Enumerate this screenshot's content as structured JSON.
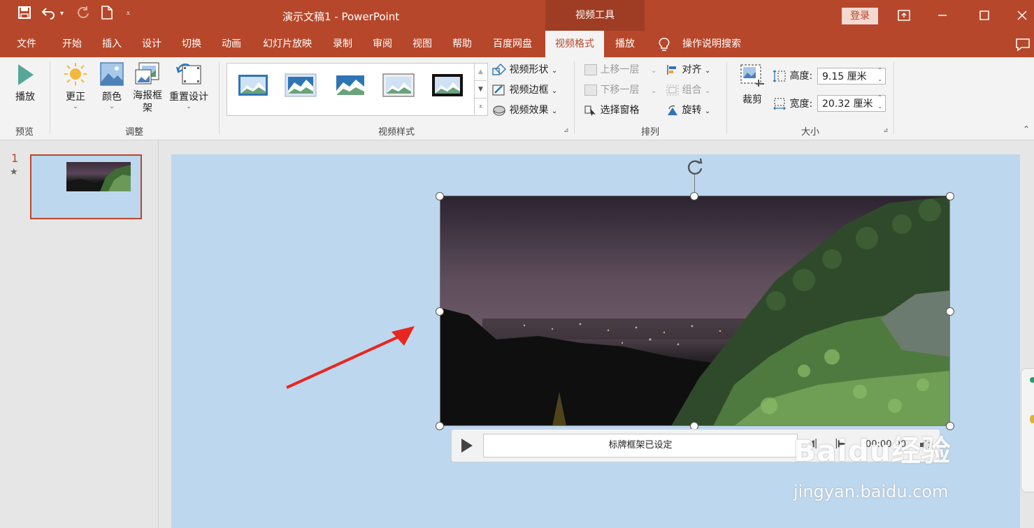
{
  "qat": {
    "save_icon": "save-icon",
    "undo_icon": "undo-icon",
    "redo_icon": "redo-icon",
    "new_icon": "new-file-icon",
    "more_icon": "customize-icon"
  },
  "titlebar": {
    "title": "演示文稿1  -  PowerPoint",
    "context_tab": "视频工具",
    "login": "登录"
  },
  "tabs": [
    "文件",
    "开始",
    "插入",
    "设计",
    "切换",
    "动画",
    "幻灯片放映",
    "录制",
    "审阅",
    "视图",
    "帮助",
    "百度网盘",
    "视频格式",
    "播放"
  ],
  "active_tab": "视频格式",
  "tellme": "操作说明搜索",
  "ribbon": {
    "preview": {
      "play": "播放",
      "group": "预览"
    },
    "adjust": {
      "correct": "更正",
      "color": "颜色",
      "poster": "海报框架",
      "reset": "重置设计",
      "group": "调整"
    },
    "styles": {
      "shape": "视频形状",
      "border": "视频边框",
      "effects": "视频效果",
      "group": "视频样式"
    },
    "arrange": {
      "forward": "上移一层",
      "backward": "下移一层",
      "pane": "选择窗格",
      "align": "对齐",
      "group_btn": "组合",
      "rotate": "旋转",
      "group": "排列"
    },
    "size": {
      "crop": "裁剪",
      "height_label": "高度:",
      "height_value": "9.15 厘米",
      "width_label": "宽度:",
      "width_value": "20.32 厘米",
      "group": "大小"
    }
  },
  "slides_pane": {
    "slide_number": "1",
    "star": "★"
  },
  "video": {
    "caption": "标牌框架已设定",
    "time": "00:00.00"
  },
  "watermark": {
    "main": "Baidu经验",
    "sub": "jingyan.baidu.com"
  },
  "colors": {
    "accent": "#b7472a",
    "slide_bg": "#bdd7ee",
    "arrow": "#e8261f"
  }
}
